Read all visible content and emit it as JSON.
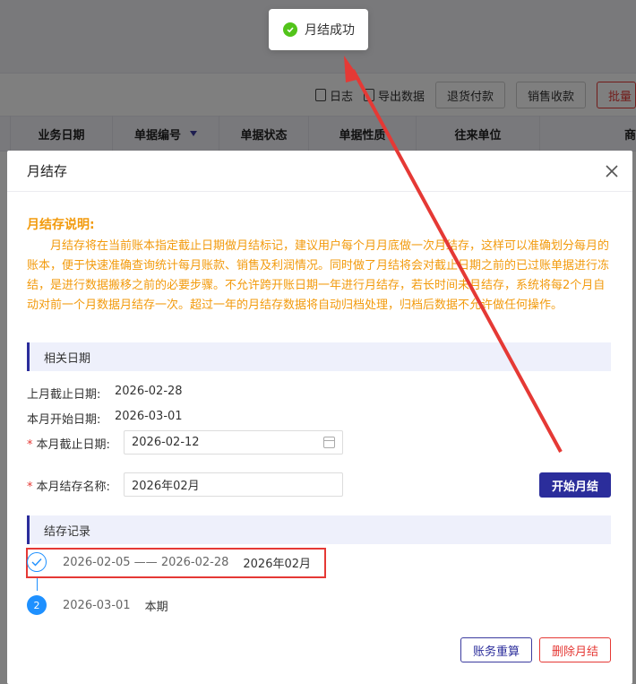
{
  "toast": {
    "message": "月结成功",
    "icon": "check-circle-icon"
  },
  "toolbar": {
    "log_label": "日志",
    "export_label": "导出数据",
    "return_payment_label": "退货付款",
    "sales_receipt_label": "销售收款",
    "batch_label": "批量"
  },
  "table": {
    "headers": [
      "业务日期",
      "单据编号",
      "单据状态",
      "单据性质",
      "往来单位",
      "商"
    ]
  },
  "modal": {
    "title": "月结存",
    "close_label": "X",
    "description_title": "月结存说明:",
    "description_body": "月结存将在当前账本指定截止日期做月结标记，建议用户每个月月底做一次月结存，这样可以准确划分每月的账本，便于快速准确查询统计每月账款、销售及利润情况。同时做了月结将会对截止日期之前的已过账单据进行冻结，是进行数据搬移之前的必要步骤。不允许跨开账日期一年进行月结存，若长时间未月结存，系统将每2个月自动对前一个月数据月结存一次。超过一年的月结存数据将自动归档处理，归档后数据不允许做任何操作。",
    "section_dates": "相关日期",
    "last_end_label": "上月截止日期:",
    "last_end_value": "2026-02-28",
    "this_start_label": "本月开始日期:",
    "this_start_value": "2026-03-01",
    "this_end_label": "本月截止日期:",
    "this_end_value": "2026-02-12",
    "name_label": "本月结存名称:",
    "name_value": "2026年02月",
    "start_button": "开始月结",
    "section_records": "结存记录",
    "records": [
      {
        "range": "2026-02-05 —— 2026-02-28",
        "name": "2026年02月",
        "marker": "check-icon"
      },
      {
        "range": "2026-03-01",
        "name": "本期",
        "marker": "2"
      }
    ],
    "recalc_button": "账务重算",
    "delete_button": "删除月结"
  },
  "colors": {
    "primary": "#2b2d9b",
    "warning_text": "#f29a0c",
    "danger": "#e53935",
    "timeline_blue": "#1e90ff",
    "success": "#52c41a"
  }
}
